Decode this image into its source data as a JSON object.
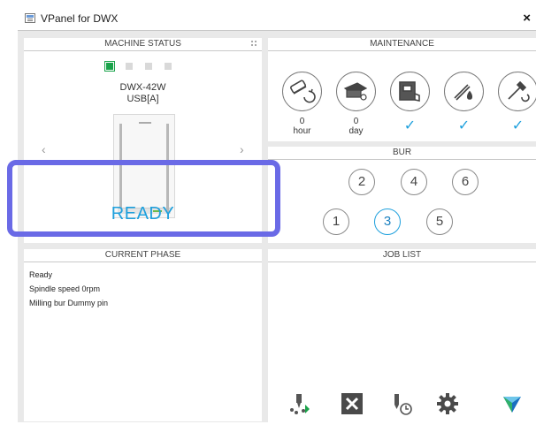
{
  "window": {
    "title": "VPanel for DWX",
    "close": "×"
  },
  "machine_status": {
    "header": "MACHINE STATUS",
    "model": "DWX-42W",
    "connection": "USB[A]",
    "status": "READY",
    "nav_left": "‹",
    "nav_right": "›"
  },
  "maintenance": {
    "header": "MAINTENANCE",
    "items": [
      {
        "icon": "spindle-rotate-icon",
        "value": "0",
        "unit": "hour"
      },
      {
        "icon": "daily-care-icon",
        "value": "0",
        "unit": "day"
      },
      {
        "icon": "dust-collector-icon",
        "check": "✓"
      },
      {
        "icon": "air-blow-icon",
        "check": "✓"
      },
      {
        "icon": "bur-replace-icon",
        "check": "✓"
      }
    ]
  },
  "bur": {
    "header": "BUR",
    "slots": [
      "2",
      "4",
      "6",
      "1",
      "3",
      "5"
    ],
    "active": "3"
  },
  "current_phase": {
    "header": "CURRENT PHASE",
    "lines": [
      "Ready",
      "Spindle speed  0rpm",
      "Milling bur  Dummy pin"
    ]
  },
  "job_list": {
    "header": "JOB LIST"
  },
  "toolbar": {
    "buttons": [
      "start-milling-icon",
      "cancel-job-icon",
      "scheduled-job-icon",
      "settings-icon",
      "vpanel-logo-icon"
    ]
  },
  "colors": {
    "accent": "#1ea0dd",
    "active_dot": "#1aa34a",
    "highlight": "#6a6ae6"
  }
}
